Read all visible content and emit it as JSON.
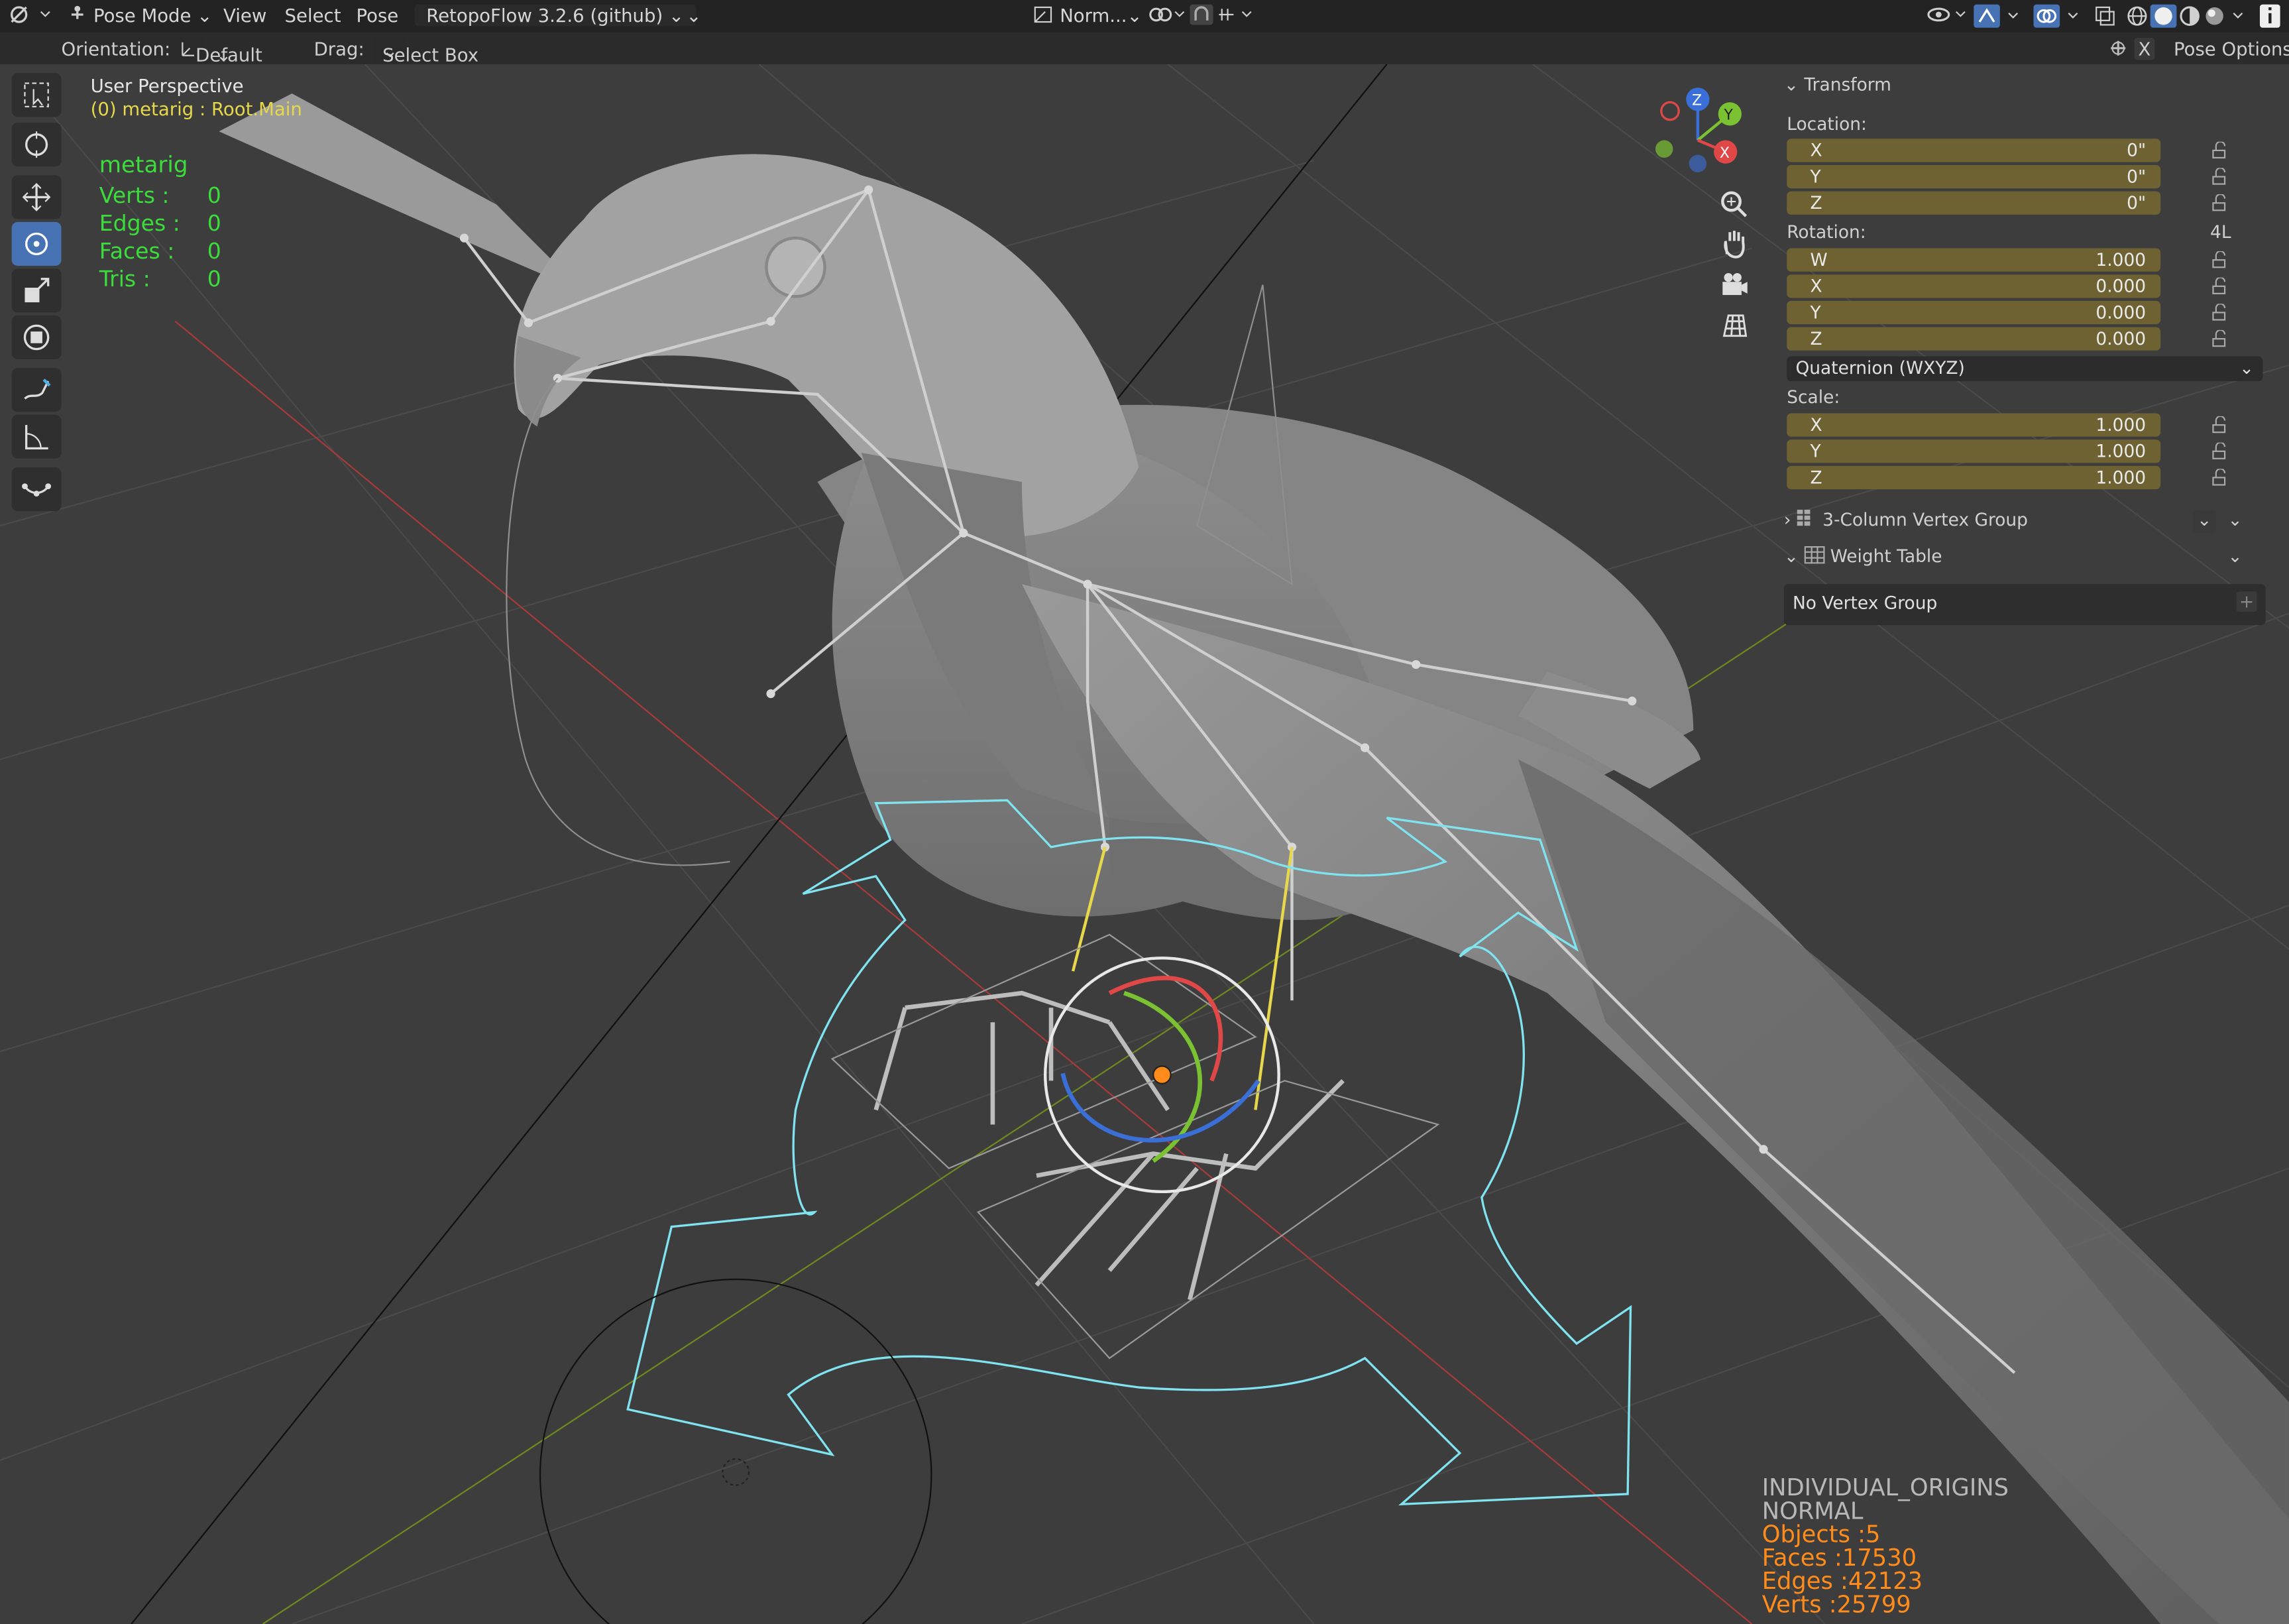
{
  "topbar": {
    "mode": "Pose Mode",
    "menu": [
      "View",
      "Select",
      "Pose"
    ],
    "addon": "RetopoFlow 3.2.6 (github)",
    "transform_orientation": "Norm..."
  },
  "toolbar": {
    "orientation_label": "Orientation:",
    "orientation_value": "Default",
    "drag_label": "Drag:",
    "drag_value": "Select Box",
    "close_x": "X",
    "pose_options": "Pose Options"
  },
  "viewport": {
    "perspective": "User Perspective",
    "active_object": "(0) metarig : Root.Main",
    "stats_object": "metarig",
    "stats": [
      {
        "label": "Verts :",
        "value": "0"
      },
      {
        "label": "Edges :",
        "value": "0"
      },
      {
        "label": "Faces :",
        "value": "0"
      },
      {
        "label": "Tris :",
        "value": "0"
      }
    ],
    "gizmo_axes": {
      "z": "Z",
      "y": "Y",
      "x": "X"
    },
    "overlay_info": {
      "pivot": "INDIVIDUAL_ORIGINS",
      "orientation": "NORMAL",
      "objects": "Objects :5",
      "faces": "Faces :17530",
      "edges": "Edges :42123",
      "verts": "Verts :25799"
    },
    "colors": {
      "stats_green": "#3ddc3d",
      "active_yellow": "#e6d84a",
      "overlay_orange": "#ff8c1a",
      "overlay_grey": "#b8b8b8",
      "gizmo_cyan": "#7fe3f0"
    }
  },
  "transform_panel": {
    "title": "Transform",
    "location_label": "Location:",
    "location": [
      {
        "axis": "X",
        "value": "0\""
      },
      {
        "axis": "Y",
        "value": "0\""
      },
      {
        "axis": "Z",
        "value": "0\""
      }
    ],
    "rotation_label": "Rotation:",
    "rotation_lock_mode": "4L",
    "rotation": [
      {
        "axis": "W",
        "value": "1.000"
      },
      {
        "axis": "X",
        "value": "0.000"
      },
      {
        "axis": "Y",
        "value": "0.000"
      },
      {
        "axis": "Z",
        "value": "0.000"
      }
    ],
    "rotation_mode": "Quaternion (WXYZ)",
    "scale_label": "Scale:",
    "scale": [
      {
        "axis": "X",
        "value": "1.000"
      },
      {
        "axis": "Y",
        "value": "1.000"
      },
      {
        "axis": "Z",
        "value": "1.000"
      }
    ],
    "panel_vertex_group": "3-Column Vertex Group",
    "panel_weight_table": "Weight Table",
    "no_vertex_group": "No Vertex Group"
  }
}
